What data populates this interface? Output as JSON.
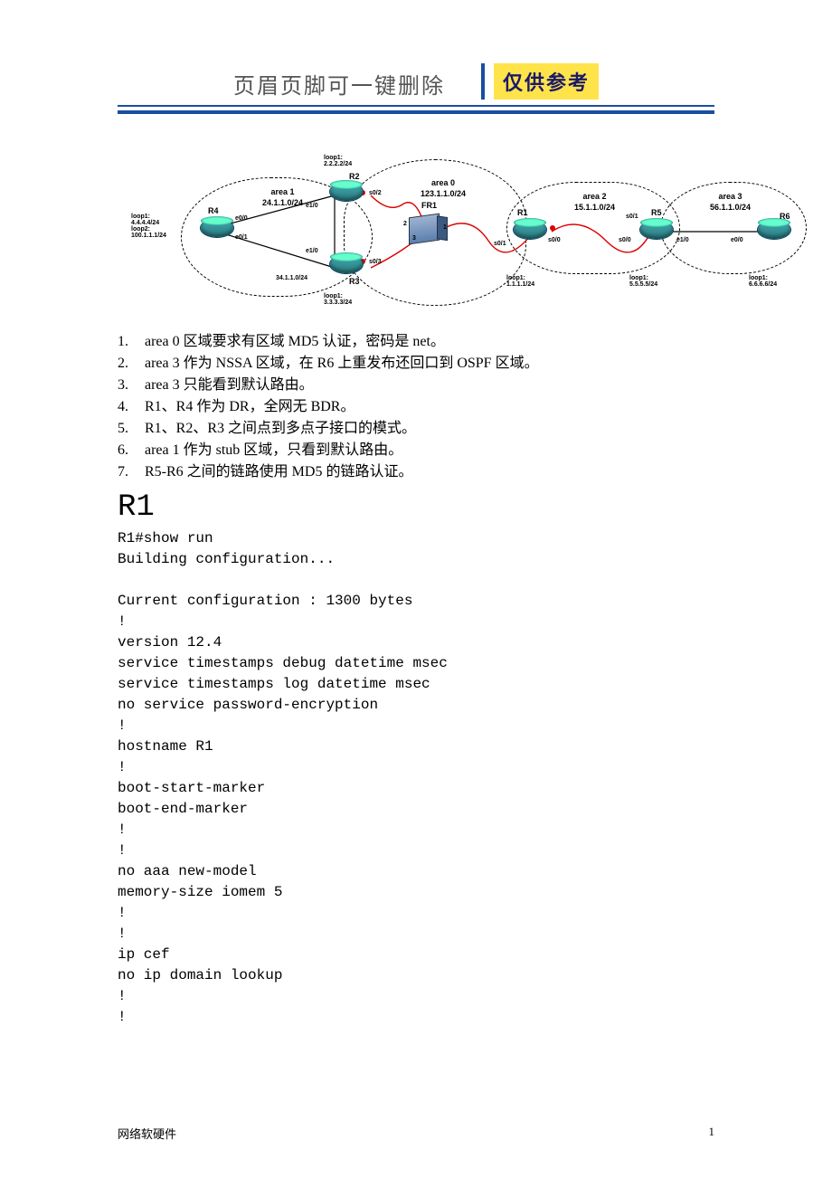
{
  "header": {
    "title": "页眉页脚可一键删除",
    "ref_badge": "仅供参考"
  },
  "diagram": {
    "areas": {
      "area0": {
        "label": "area 0",
        "subnet": "123.1.1.0/24"
      },
      "area1": {
        "label": "area 1",
        "subnet": "24.1.1.0/24"
      },
      "area2": {
        "label": "area 2",
        "subnet": "15.1.1.0/24"
      },
      "area3": {
        "label": "area 3",
        "subnet": "56.1.1.0/24"
      }
    },
    "routers": {
      "R1": {
        "name": "R1",
        "loop": "loop1:\n1.1.1.1/24"
      },
      "R2": {
        "name": "R2",
        "loop": "loop1:\n2.2.2.2/24"
      },
      "R3": {
        "name": "R3",
        "loop": "loop1:\n3.3.3.3/24"
      },
      "R4": {
        "name": "R4",
        "loop": "loop1:\n4.4.4.4/24\nloop2:\n100.1.1.1/24"
      },
      "R5": {
        "name": "R5",
        "loop": "loop1:\n5.5.5.5/24"
      },
      "R6": {
        "name": "R6",
        "loop": "loop1:\n6.6.6.6/24"
      }
    },
    "fr": {
      "name": "FR1",
      "ports": {
        "p1": "1",
        "p2": "2",
        "p3": "3"
      }
    },
    "iface": {
      "e00": "e0/0",
      "e01": "e0/1",
      "e10": "e1/0",
      "s00": "s0/0",
      "s01": "s0/1",
      "s02": "s0/2",
      "s03": "s0/3"
    },
    "links": {
      "r3r4": "34.1.1.0/24"
    }
  },
  "requirements": [
    "area 0 区域要求有区域 MD5 认证，密码是 net。",
    "area 3 作为 NSSA 区域，在 R6 上重发布还回口到 OSPF 区域。",
    "area 3 只能看到默认路由。",
    "R1、R4 作为 DR，全网无 BDR。",
    "R1、R2、R3 之间点到多点子接口的模式。",
    "area 1 作为 stub 区域，只看到默认路由。",
    "R5-R6 之间的链路使用 MD5 的链路认证。"
  ],
  "device": {
    "heading": "R1",
    "lines": [
      "R1#show run",
      "Building configuration...",
      "",
      "Current configuration : 1300 bytes",
      "!",
      "version 12.4",
      "service timestamps debug datetime msec",
      "service timestamps log datetime msec",
      "no service password-encryption",
      "!",
      "hostname R1",
      "!",
      "boot-start-marker",
      "boot-end-marker",
      "!",
      "!",
      "no aaa new-model",
      "memory-size iomem 5",
      "!",
      "!",
      "ip cef",
      "no ip domain lookup",
      "!",
      "!"
    ]
  },
  "footer": {
    "left": "网络软硬件",
    "right": "1"
  }
}
